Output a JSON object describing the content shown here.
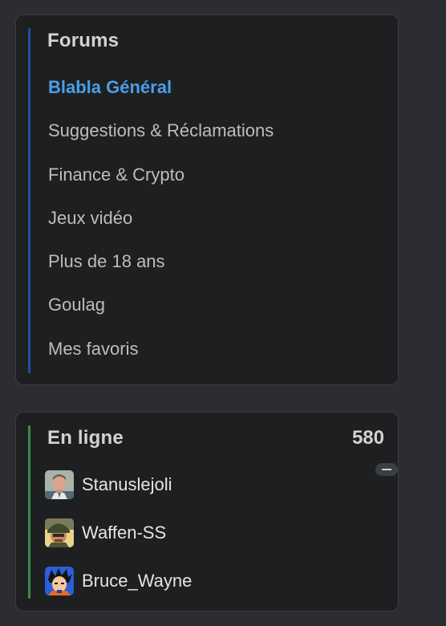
{
  "forums": {
    "title": "Forums",
    "accent_color": "#1f4fa8",
    "active_color": "#4a9fe8",
    "items": [
      {
        "label": "Blabla Général",
        "active": true
      },
      {
        "label": "Suggestions & Réclamations",
        "active": false
      },
      {
        "label": "Finance & Crypto",
        "active": false
      },
      {
        "label": "Jeux vidéo",
        "active": false
      },
      {
        "label": "Plus de 18 ans",
        "active": false
      },
      {
        "label": "Goulag",
        "active": false
      },
      {
        "label": "Mes favoris",
        "active": false
      }
    ]
  },
  "online": {
    "title": "En ligne",
    "count": "580",
    "accent_color": "#3a8a4c",
    "users": [
      {
        "name": "Stanuslejoli",
        "avatar": "portrait-avatar"
      },
      {
        "name": "Waffen-SS",
        "avatar": "soldier-avatar"
      },
      {
        "name": "Bruce_Wayne",
        "avatar": "anime-avatar"
      }
    ]
  }
}
